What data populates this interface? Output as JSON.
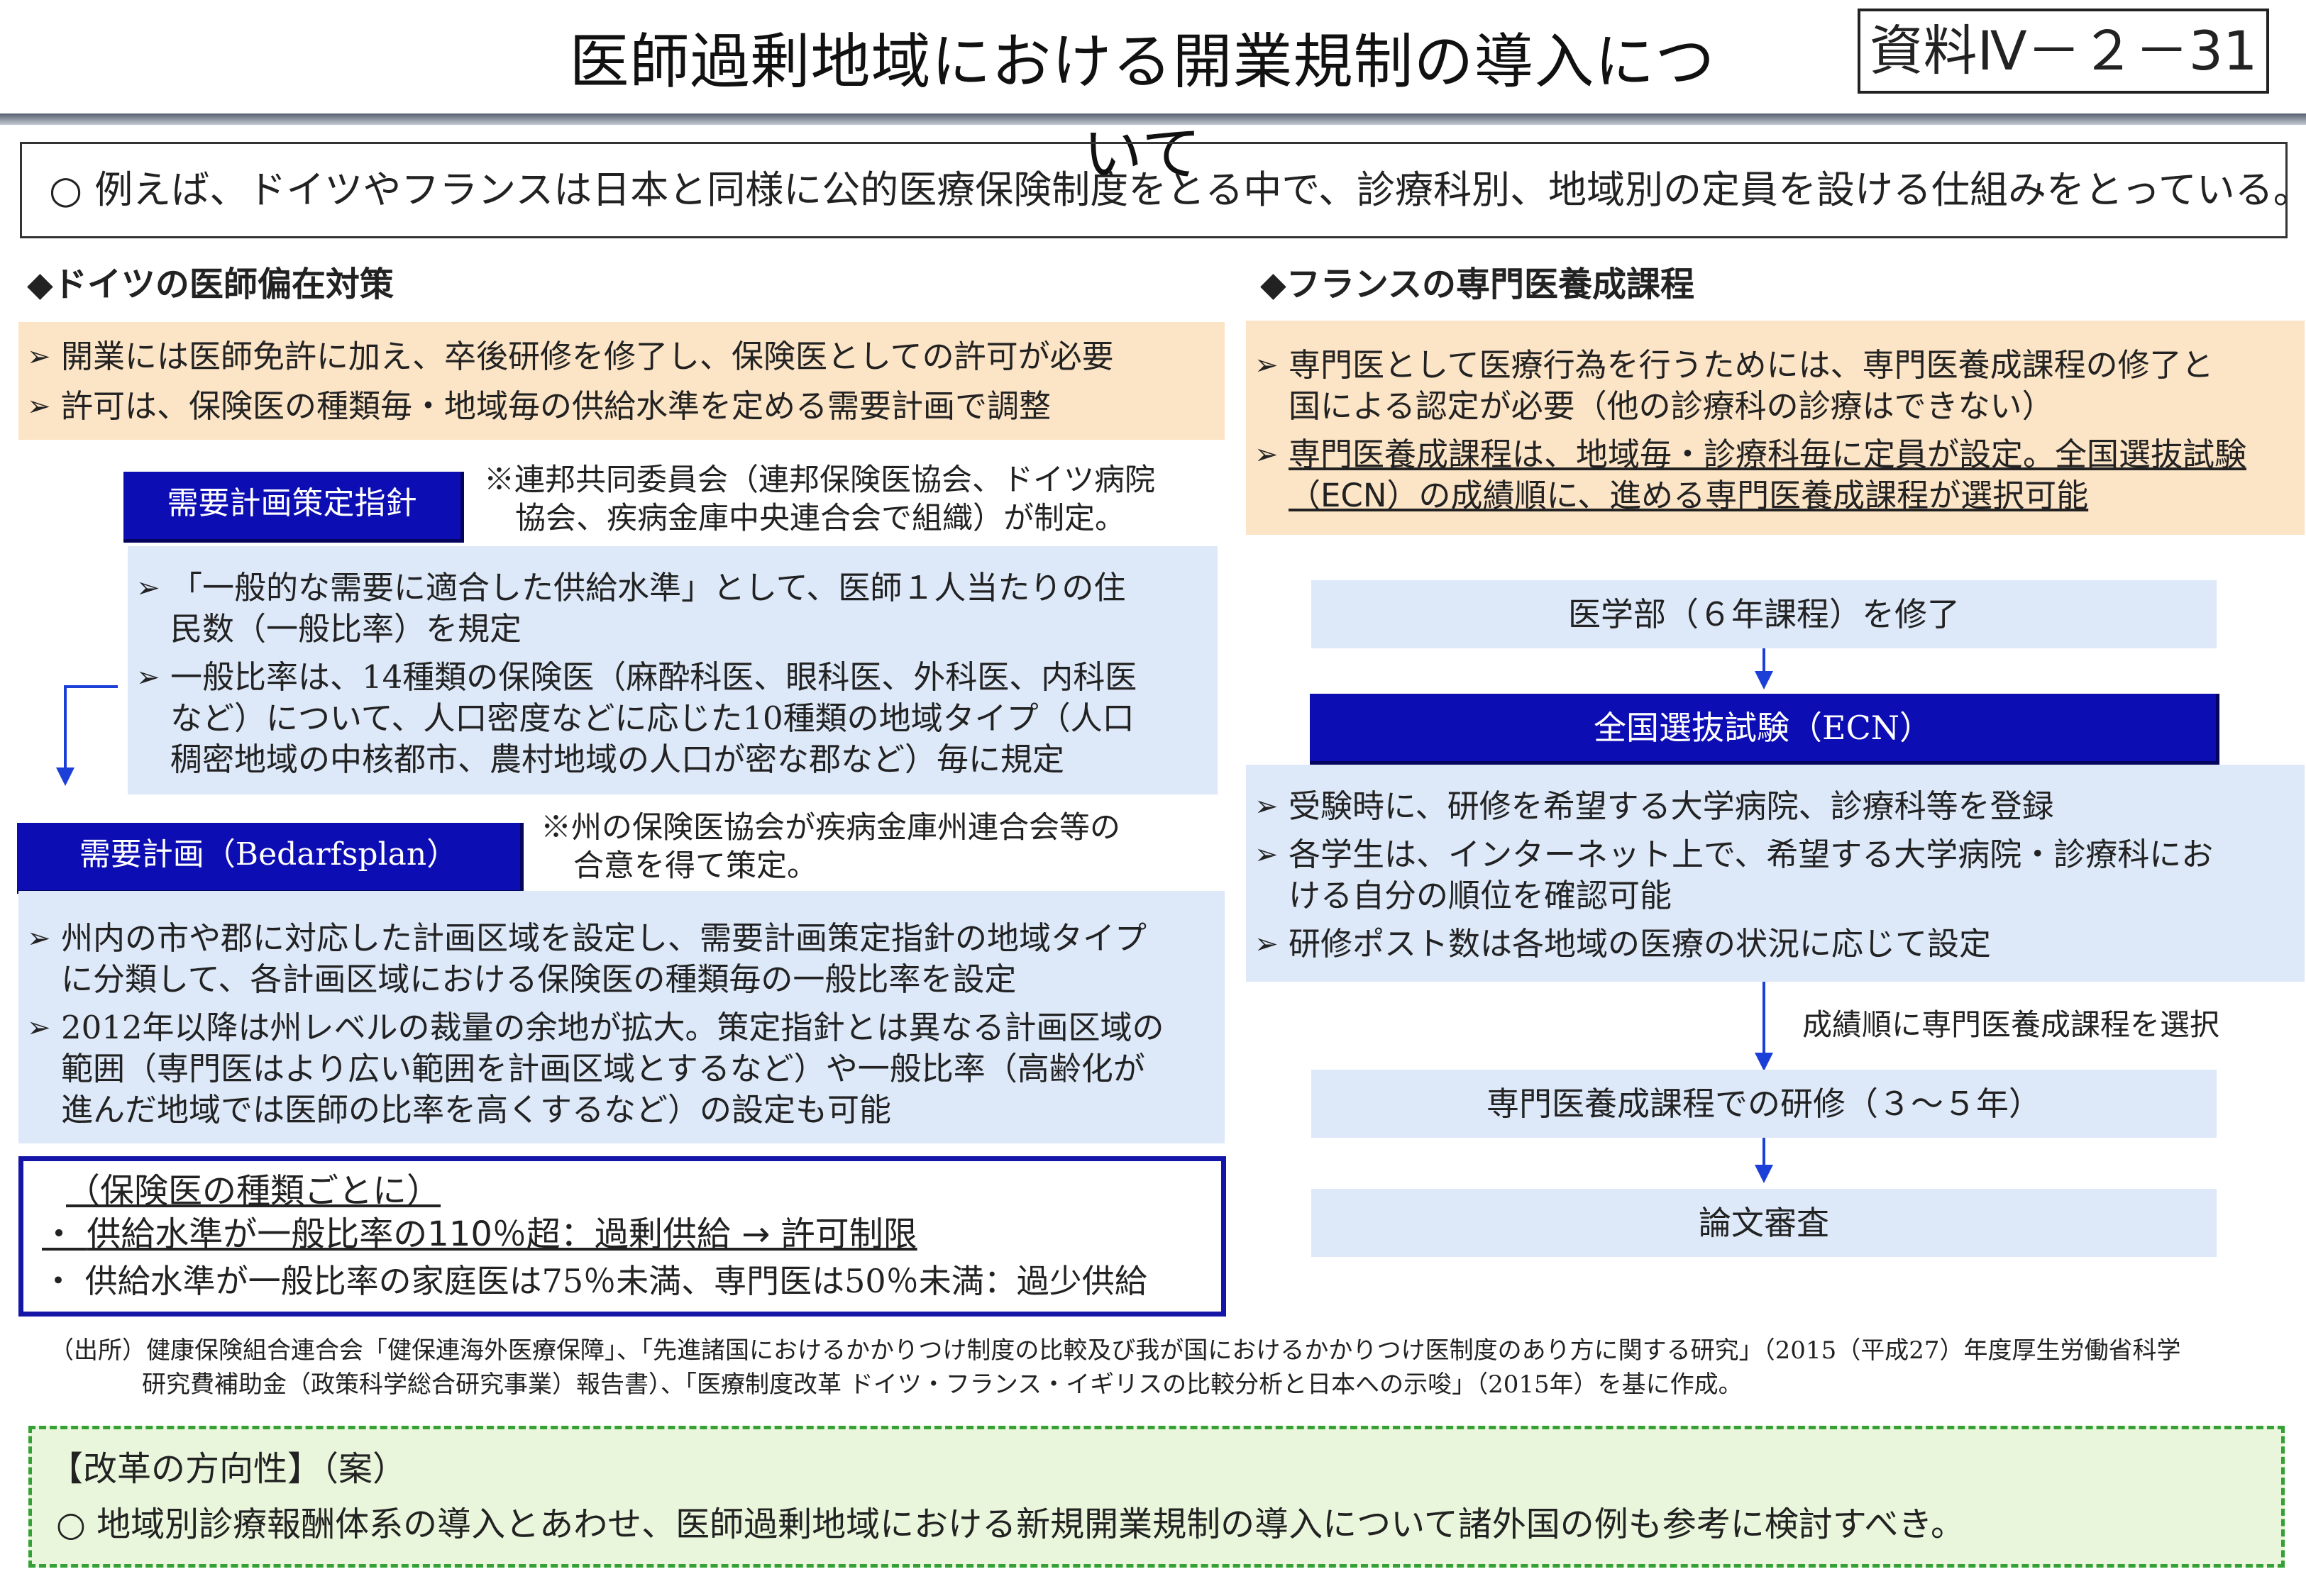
{
  "header": {
    "title": "医師過剰地域における開業規制の導入について",
    "doc_number": "資料Ⅳ－２－31"
  },
  "intro": "○ 例えば、ドイツやフランスは日本と同様に公的医療保険制度をとる中で、診療科別、地域別の定員を設ける仕組みをとっている。",
  "germany": {
    "heading": "◆ドイツの医師偏在対策",
    "summary": [
      "開業には医師免許に加え、卒後研修を修了し、保険医としての許可が必要",
      "許可は、保険医の種類毎・地域毎の供給水準を定める需要計画で調整"
    ],
    "guideline": {
      "label": "需要計画策定指針",
      "note_line1": "※連邦共同委員会（連邦保険医協会、ドイツ病院",
      "note_line2": "協会、疾病金庫中央連合会で組織）が制定。",
      "items": [
        {
          "line1": "「一般的な需要に適合した供給水準」として、医師１人当たりの住",
          "line2": "民数（一般比率）を規定"
        },
        {
          "line1": "一般比率は、14種類の保険医（麻酔科医、眼科医、外科医、内科医",
          "line2": "など）について、人口密度などに応じた10種類の地域タイプ（人口",
          "line3": "稠密地域の中核都市、農村地域の人口が密な郡など）毎に規定"
        }
      ]
    },
    "plan": {
      "label": "需要計画（Bedarfsplan）",
      "note_line1": "※州の保険医協会が疾病金庫州連合会等の",
      "note_line2": "合意を得て策定。",
      "items": [
        {
          "line1": "州内の市や郡に対応した計画区域を設定し、需要計画策定指針の地域タイプ",
          "line2": "に分類して、各計画区域における保険医の種類毎の一般比率を設定"
        },
        {
          "line1": "2012年以降は州レベルの裁量の余地が拡大。策定指針とは異なる計画区域の",
          "line2": "範囲（専門医はより広い範囲を計画区域とするなど）や一般比率（高齢化が",
          "line3": "進んだ地域では医師の比率を高くするなど）の設定も可能"
        }
      ]
    },
    "criteria": {
      "header": "（保険医の種類ごとに）",
      "bullet": "・",
      "line1": "供給水準が一般比率の110％超：過剰供給 → 許可制限",
      "line2": "供給水準が一般比率の家庭医は75％未満、専門医は50％未満：過少供給"
    }
  },
  "france": {
    "heading": "◆フランスの専門医養成課程",
    "summary": [
      {
        "line1": "専門医として医療行為を行うためには、専門医養成課程の修了と",
        "line2": "国による認定が必要（他の診療科の診療はできない）"
      },
      {
        "line1": "専門医養成課程は、地域毎・診療科毎に定員が設定。全国選抜試験",
        "line2": "（ECN）の成績順に、進める専門医養成課程が選択可能"
      }
    ],
    "flow": {
      "step1": "医学部（６年課程）を修了",
      "step2": "全国選抜試験（ECN）",
      "step2_items": [
        {
          "line1": "受験時に、研修を希望する大学病院、診療科等を登録"
        },
        {
          "line1": "各学生は、インターネット上で、希望する大学病院・診療科にお",
          "line2": "ける自分の順位を確認可能"
        },
        {
          "line1": "研修ポスト数は各地域の医療の状況に応じて設定"
        }
      ],
      "arrow_label": "成績順に専門医養成課程を選択",
      "step3": "専門医養成課程での研修（３～５年）",
      "step4": "論文審査"
    }
  },
  "source": {
    "line1": "（出所）健康保険組合連合会「健保連海外医療保障」、「先進諸国におけるかかりつけ制度の比較及び我が国におけるかかりつけ医制度のあり方に関する研究」（2015（平成27）年度厚生労働省科学",
    "line2": "研究費補助金（政策科学総合研究事業）報告書）、「医療制度改革 ドイツ・フランス・イギリスの比較分析と日本への示唆」（2015年）を基に作成。"
  },
  "reform": {
    "heading": "【改革の方向性】（案）",
    "text": "○ 地域別診療報酬体系の導入とあわせ、医師過剰地域における新規開業規制の導入について諸外国の例も参考に検討すべき。"
  },
  "icons": {
    "bullet": "➢"
  },
  "colors": {
    "navy_label": "#0d0db4",
    "peach_panel": "#fce4c6",
    "blue_panel": "#dde8f8",
    "arrow": "#1c3fd8",
    "reform_border": "#35a035",
    "reform_bg": "#eaf6dc"
  }
}
